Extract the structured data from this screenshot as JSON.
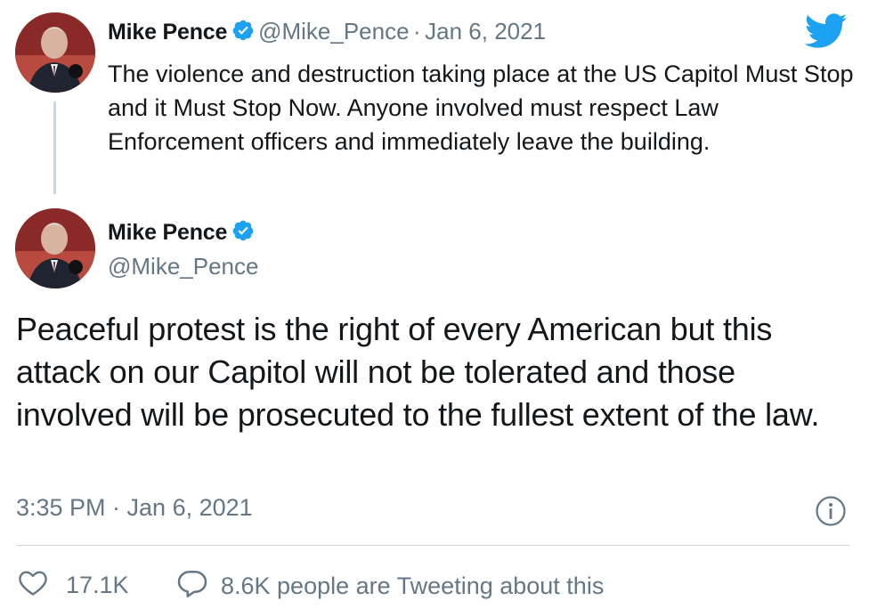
{
  "reply_tweet": {
    "author_name": "Mike Pence",
    "handle": "@Mike_Pence",
    "separator": "·",
    "date": "Jan 6, 2021",
    "text": "The violence and destruction taking place at the US Capitol Must Stop and it Must Stop Now. Anyone involved must respect Law Enforcement officers and immediately leave the building."
  },
  "main_tweet": {
    "author_name": "Mike Pence",
    "handle": "@Mike_Pence",
    "text": "Peaceful protest is the right of every American but this attack on our Capitol will not be tolerated and those involved will be prosecuted to the fullest extent of the law.",
    "timestamp": "3:35 PM · Jan 6, 2021",
    "likes": "17.1K",
    "conversation": "8.6K people are Tweeting about this"
  },
  "colors": {
    "twitter_blue": "#1DA1F2",
    "secondary_text": "#657786",
    "primary_text": "#14171a",
    "divider": "#ccd6dd"
  },
  "icons": [
    "twitter-bird-icon",
    "verified-badge-icon",
    "info-icon",
    "heart-icon",
    "reply-bubble-icon"
  ]
}
